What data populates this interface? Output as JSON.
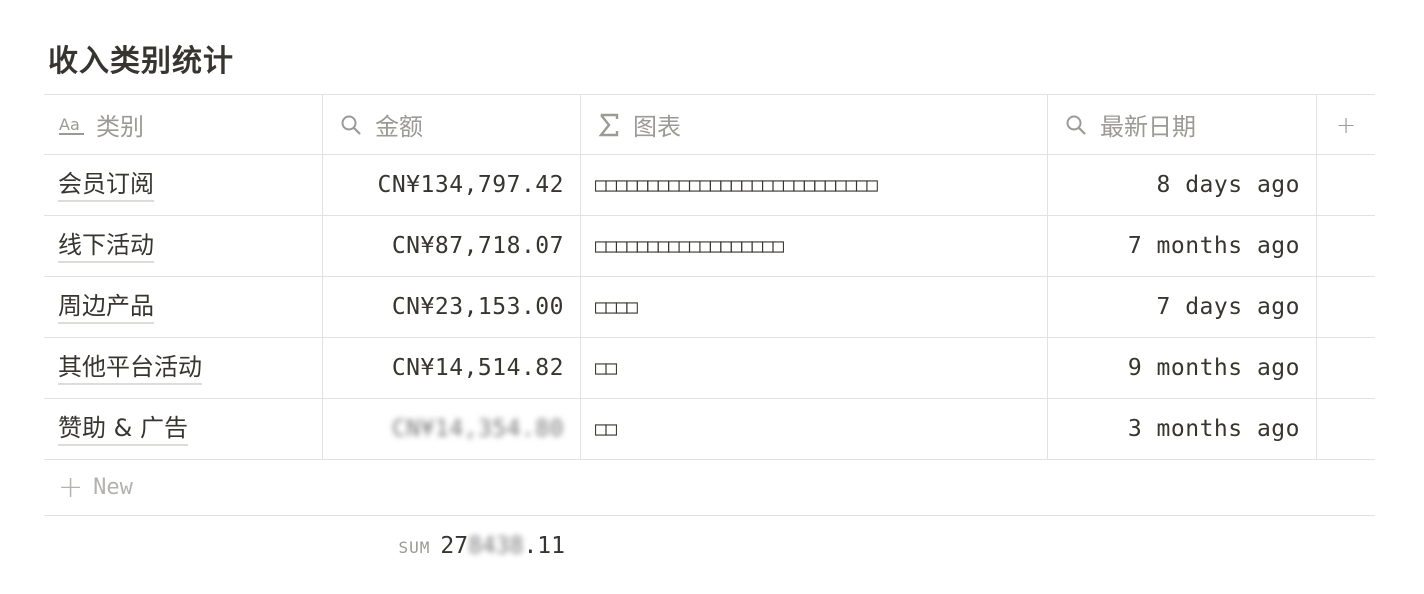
{
  "page": {
    "title": "收入类别统计"
  },
  "columns": [
    {
      "icon": "text-type-icon",
      "label": "类别"
    },
    {
      "icon": "search-icon",
      "label": "金额"
    },
    {
      "icon": "sigma-icon",
      "label": "图表"
    },
    {
      "icon": "search-icon",
      "label": "最新日期"
    }
  ],
  "add_column_label": "+",
  "rows": [
    {
      "category": "会员订阅",
      "amount": "CN¥134,797.42",
      "chart": "□□□□□□□□□□□□□□□□□□□□□□□□□□□",
      "date": "8 days ago"
    },
    {
      "category": "线下活动",
      "amount": "CN¥87,718.07",
      "chart": "□□□□□□□□□□□□□□□□□□",
      "date": "7 months ago"
    },
    {
      "category": "周边产品",
      "amount": "CN¥23,153.00",
      "chart": "□□□□",
      "date": "7 days ago"
    },
    {
      "category": "其他平台活动",
      "amount": "CN¥14,514.82",
      "chart": "□□",
      "date": "9 months ago"
    },
    {
      "category": "赞助 & 广告",
      "amount": "CN¥14,354.80",
      "chart": "□□",
      "date": "3 months ago",
      "amount_obscured": true
    }
  ],
  "new_row_label": "New",
  "summary": {
    "label": "SUM",
    "prefix": "27",
    "obscured": "8438",
    "suffix": ".11"
  }
}
